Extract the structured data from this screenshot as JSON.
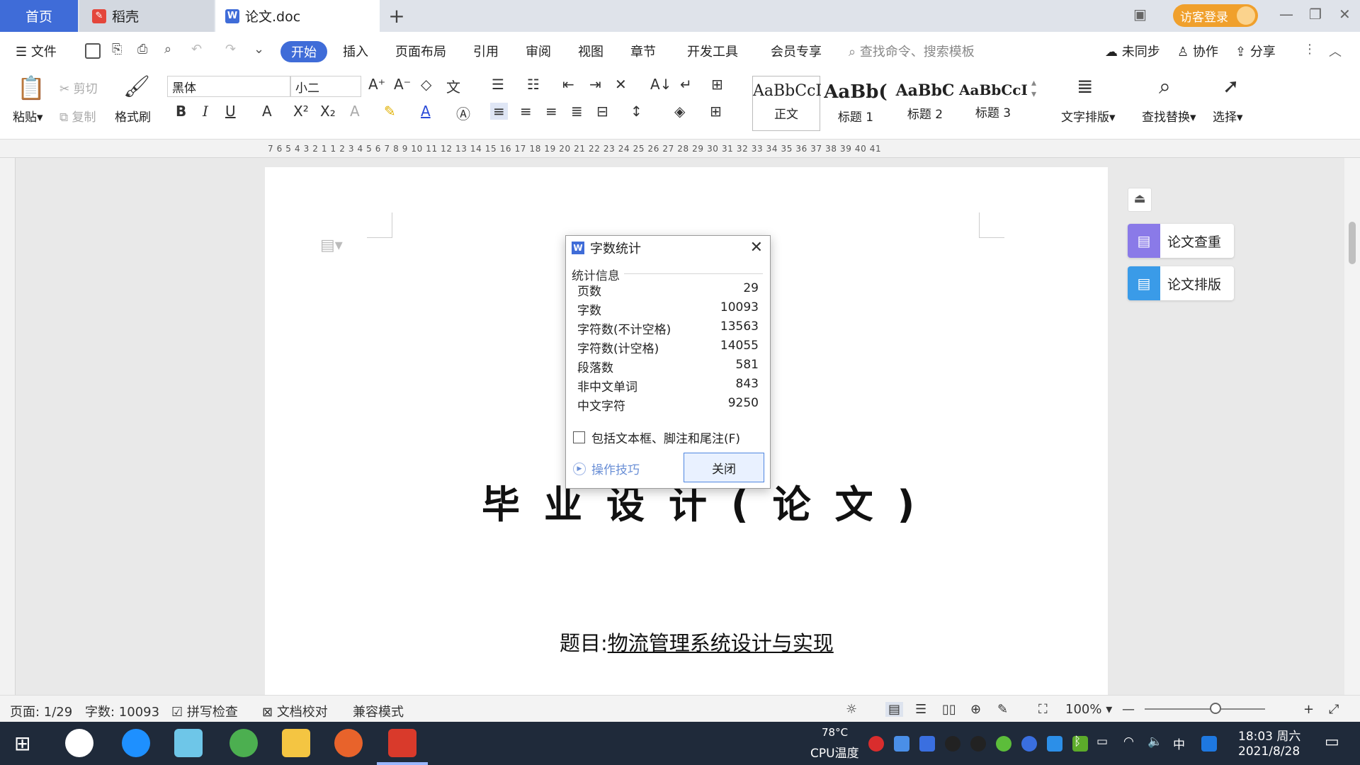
{
  "tabs": {
    "home": "首页",
    "daoke": "稻壳",
    "doc": "论文.doc",
    "add": "+"
  },
  "login": "访客登录",
  "menu": {
    "file": "文件",
    "start": "开始",
    "insert": "插入",
    "layout": "页面布局",
    "reference": "引用",
    "review": "审阅",
    "view": "视图",
    "chapter": "章节",
    "devtools": "开发工具",
    "member": "会员专享",
    "search_placeholder": "查找命令、搜索模板",
    "sync": "未同步",
    "collab": "协作",
    "share": "分享"
  },
  "ribbon": {
    "paste": "粘贴",
    "cut": "剪切",
    "copy": "复制",
    "format_painter": "格式刷",
    "font_name": "黑体",
    "font_size": "小二",
    "styles": [
      {
        "preview": "AaBbCcI",
        "label": "正文"
      },
      {
        "preview": "AaBb(",
        "label": "标题 1"
      },
      {
        "preview": "AaBbC",
        "label": "标题 2"
      },
      {
        "preview": "AaBbCcI",
        "label": "标题 3"
      }
    ],
    "text_layout": "文字排版",
    "find_replace": "查找替换",
    "select": "选择"
  },
  "ruler": "7 6 5 4 3 2 1  1 2 3 4 5 6 7 8 9 10 11 12 13 14 15 16 17 18 19 20 21 22 23 24 25 26 27 28 29 30 31 32 33 34 35 36 37 38 39 40 41",
  "document": {
    "title": "毕业设计(论文)",
    "topic_label": "题目:",
    "topic_value": "物流管理系统设计与实现"
  },
  "side_panel": {
    "check": "论文查重",
    "format": "论文排版"
  },
  "dialog": {
    "title": "字数统计",
    "section": "统计信息",
    "stats": [
      {
        "label": "页数",
        "value": "29"
      },
      {
        "label": "字数",
        "value": "10093"
      },
      {
        "label": "字符数(不计空格)",
        "value": "13563"
      },
      {
        "label": "字符数(计空格)",
        "value": "14055"
      },
      {
        "label": "段落数",
        "value": "581"
      },
      {
        "label": "非中文单词",
        "value": "843"
      },
      {
        "label": "中文字符",
        "value": "9250"
      }
    ],
    "include_checkbox": "包括文本框、脚注和尾注(F)",
    "tips": "操作技巧",
    "close": "关闭"
  },
  "status": {
    "page": "页面: 1/29",
    "words": "字数: 10093",
    "spell": "拼写检查",
    "proof": "文档校对",
    "compat": "兼容模式",
    "zoom": "100%"
  },
  "taskbar": {
    "cpu_temp": "78°C",
    "cpu_label": "CPU温度",
    "ime": "中",
    "time": "18:03 周六",
    "date": "2021/8/28"
  }
}
